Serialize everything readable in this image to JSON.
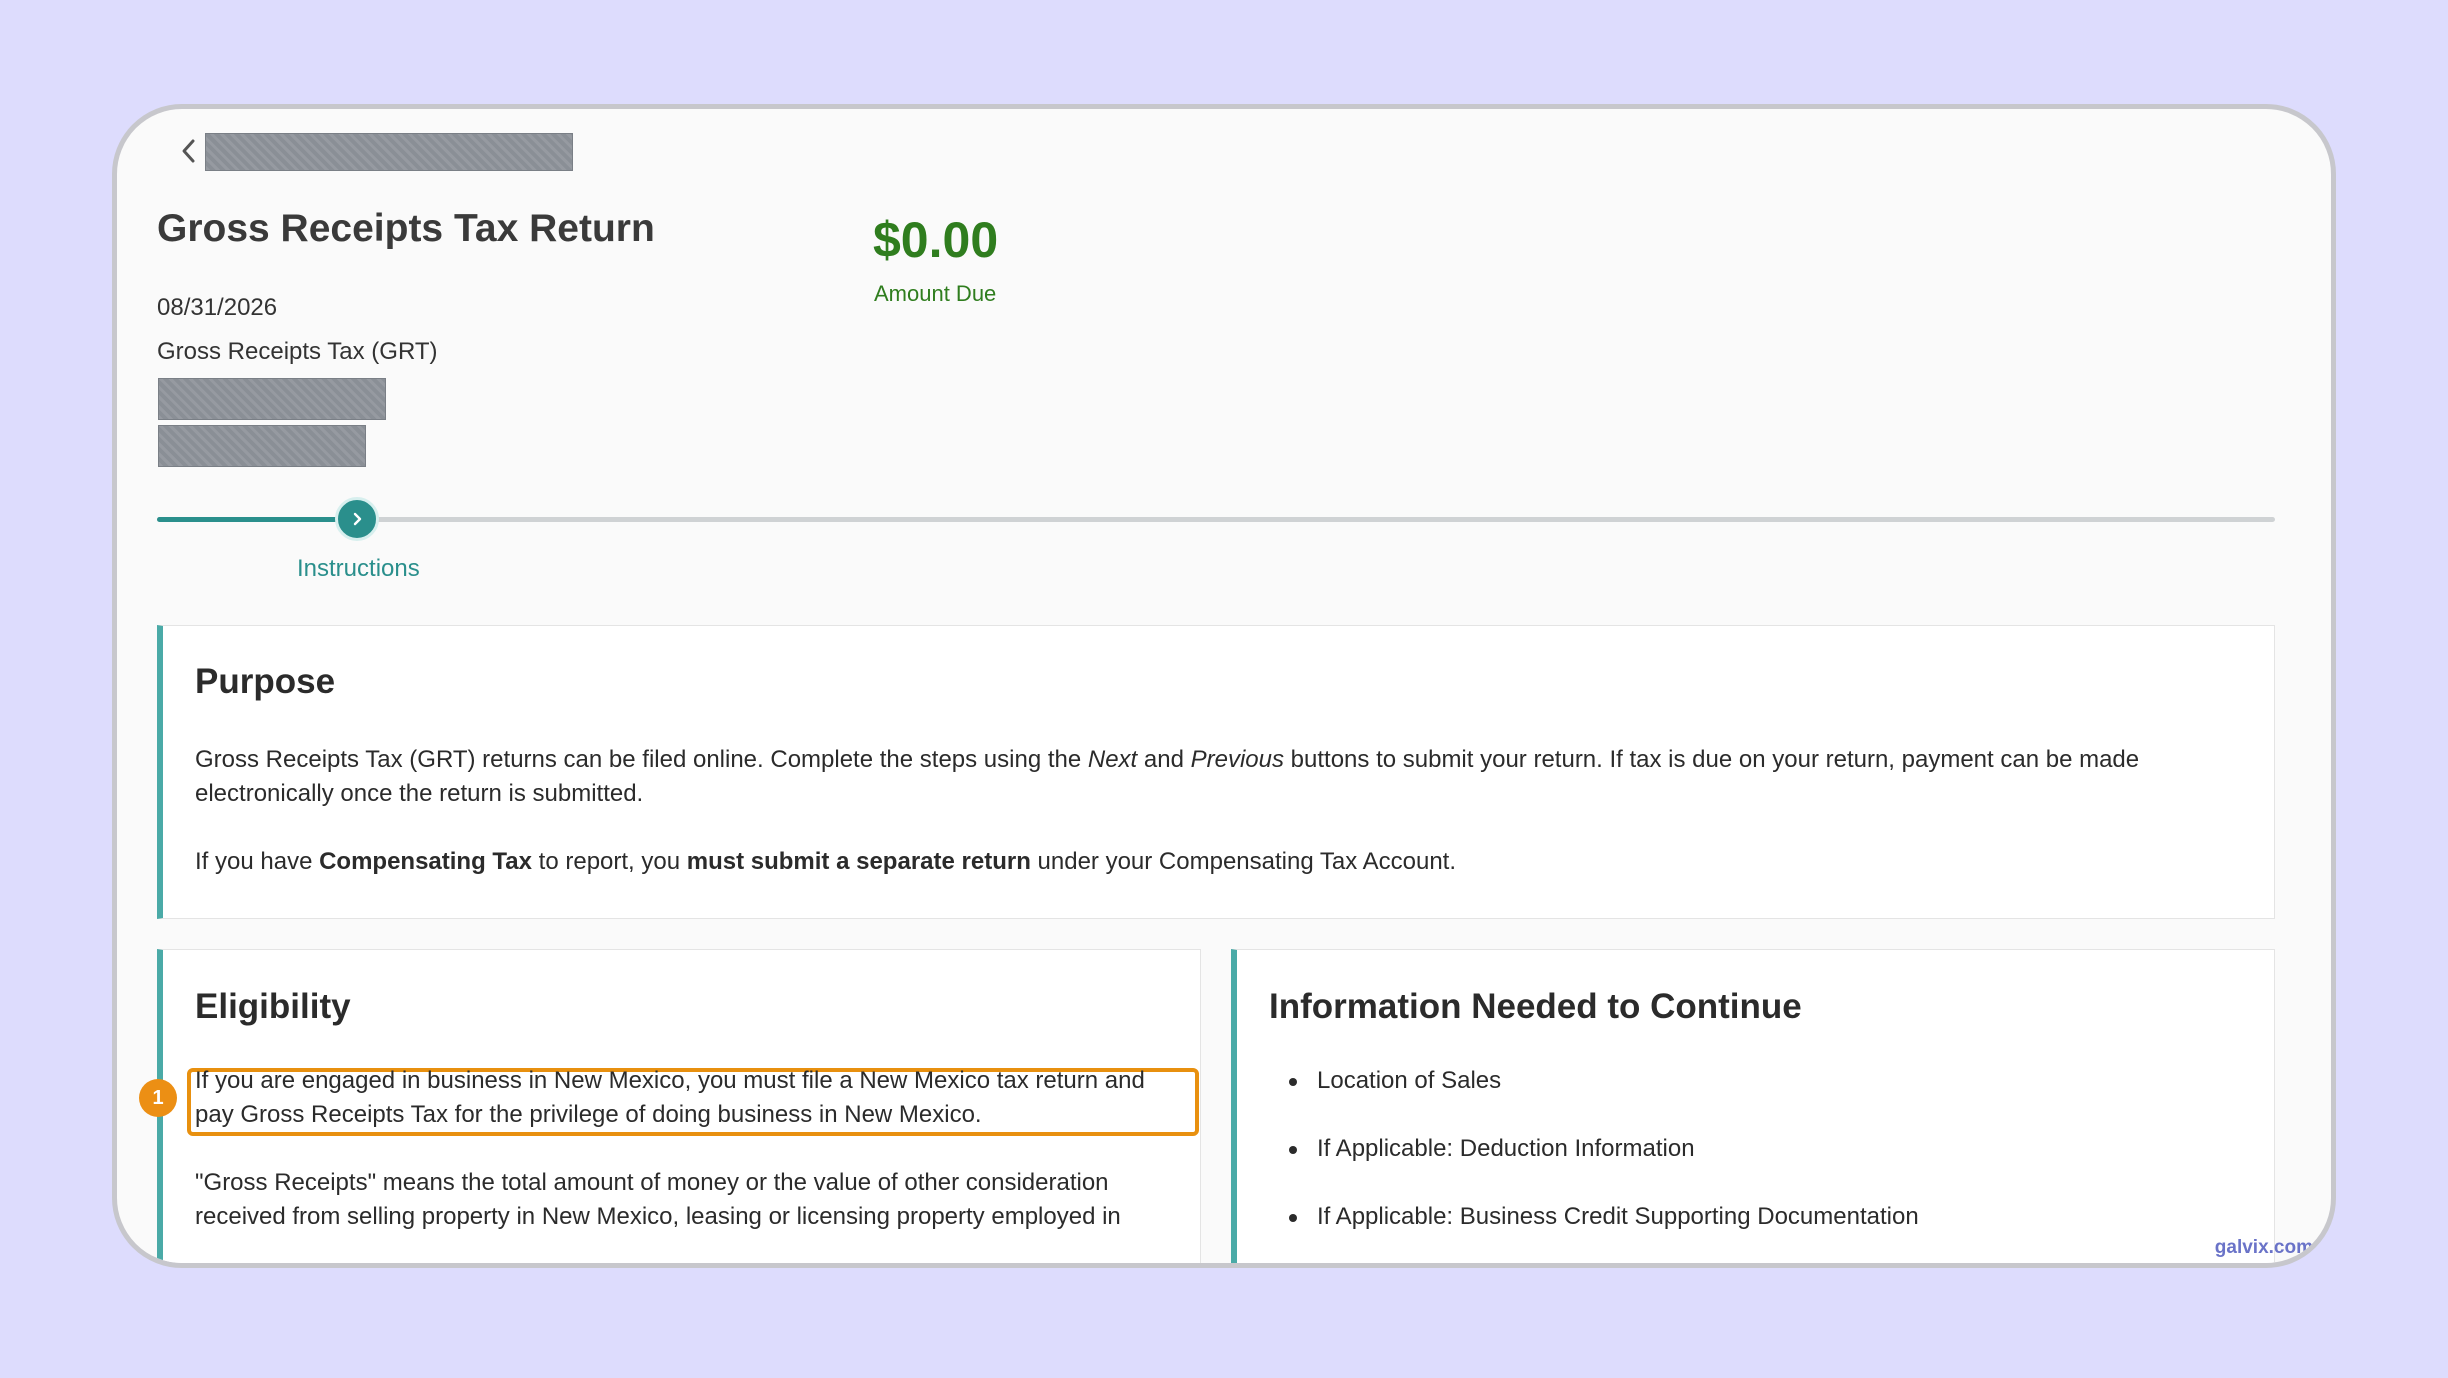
{
  "header": {
    "back_icon": "chevron-left-icon",
    "title": "Gross Receipts Tax Return",
    "date": "08/31/2026",
    "tax_type": "Gross Receipts Tax (GRT)"
  },
  "amount": {
    "value": "$0.00",
    "label": "Amount Due",
    "color": "#2f7d1e"
  },
  "stepper": {
    "current_step_label": "Instructions",
    "step_icon": "chevron-right-icon",
    "accent": "#2a8f8c"
  },
  "purpose": {
    "heading": "Purpose",
    "p1_a": "Gross Receipts Tax (GRT) returns can be filed online. Complete the steps using the ",
    "p1_next": "Next",
    "p1_and": " and ",
    "p1_previous": "Previous",
    "p1_b": " buttons to submit your return. If tax is due on your return, payment can be made electronically once the return is submitted.",
    "p2_a": "If you have ",
    "p2_bold1": "Compensating Tax",
    "p2_b": " to report, you ",
    "p2_bold2": "must submit a separate return",
    "p2_c": " under your Compensating Tax Account."
  },
  "eligibility": {
    "heading": "Eligibility",
    "p1": "If you are engaged in business in New Mexico, you must file a New Mexico tax return and pay Gross Receipts Tax for the privilege of doing business in New Mexico.",
    "p2": "\"Gross Receipts\" means the total amount of money or the value of other consideration received from selling property in New Mexico, leasing or licensing property employed in",
    "badge_number": "1"
  },
  "info_needed": {
    "heading": "Information Needed to Continue",
    "items": [
      "Location of Sales",
      "If Applicable: Deduction Information",
      "If Applicable: Business Credit Supporting Documentation"
    ]
  },
  "watermark": "galvix.com"
}
